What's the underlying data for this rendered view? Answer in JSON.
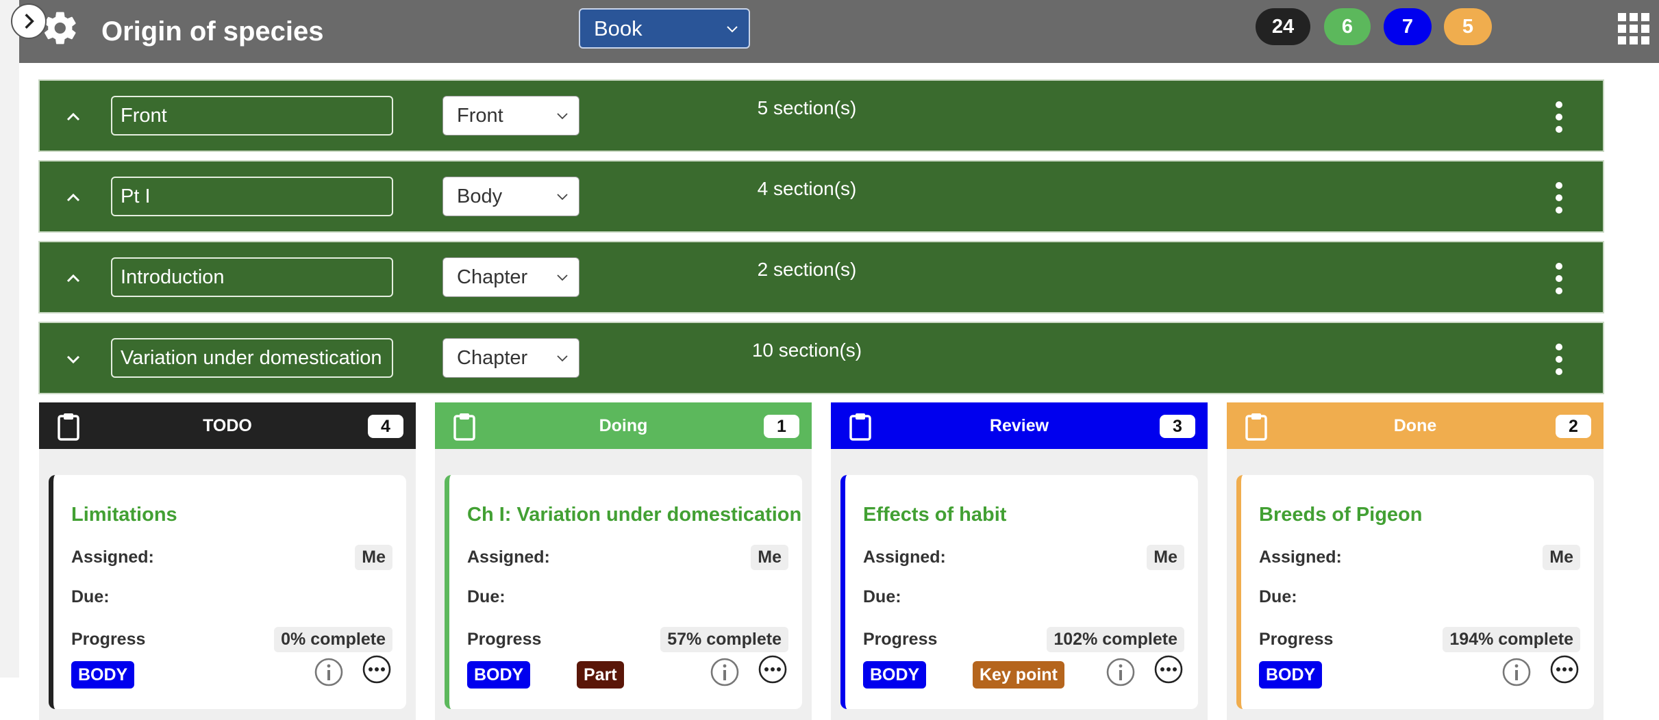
{
  "header": {
    "title": "Origin of species",
    "mode_select": "Book",
    "counters": [
      {
        "value": "24",
        "color": "#222222"
      },
      {
        "value": "6",
        "color": "#5cb85c"
      },
      {
        "value": "7",
        "color": "#0000ee"
      },
      {
        "value": "5",
        "color": "#f0ad4e"
      }
    ]
  },
  "sections": [
    {
      "name": "Front",
      "type": "Front",
      "count": "5 section(s)",
      "collapsed": false
    },
    {
      "name": "Pt I",
      "type": "Body",
      "count": "4 section(s)",
      "collapsed": false
    },
    {
      "name": "Introduction",
      "type": "Chapter",
      "count": "2 section(s)",
      "collapsed": false
    },
    {
      "name": "Variation under domestication",
      "type": "Chapter",
      "count": "10 section(s)",
      "collapsed": true
    }
  ],
  "labels": {
    "assigned": "Assigned:",
    "due": "Due:",
    "progress": "Progress"
  },
  "columns": [
    {
      "title": "TODO",
      "count": "4",
      "color": "#222222",
      "card": {
        "title": "Limitations",
        "assigned": "Me",
        "progress": "0% complete",
        "tags": [
          {
            "text": "BODY",
            "color": "#0000ee"
          }
        ]
      }
    },
    {
      "title": "Doing",
      "count": "1",
      "color": "#5cb85c",
      "card": {
        "title": "Ch I: Variation under domestication",
        "assigned": "Me",
        "progress": "57% complete",
        "tags": [
          {
            "text": "BODY",
            "color": "#0000ee"
          },
          {
            "text": "Part",
            "color": "#5a1608"
          }
        ]
      }
    },
    {
      "title": "Review",
      "count": "3",
      "color": "#0000ee",
      "card": {
        "title": "Effects of habit",
        "assigned": "Me",
        "progress": "102% complete",
        "tags": [
          {
            "text": "BODY",
            "color": "#0000ee"
          },
          {
            "text": "Key point",
            "color": "#b5651d"
          }
        ]
      }
    },
    {
      "title": "Done",
      "count": "2",
      "color": "#f0ad4e",
      "card": {
        "title": "Breeds of Pigeon",
        "assigned": "Me",
        "progress": "194% complete",
        "tags": [
          {
            "text": "BODY",
            "color": "#0000ee"
          }
        ]
      }
    }
  ],
  "icons": {
    "expand": "chevron-right-icon",
    "settings": "gear-icon",
    "apps": "grid-icon",
    "column": "clipboard-icon",
    "info": "info-icon",
    "more": "more-icon",
    "section_menu": "kebab-icon"
  }
}
